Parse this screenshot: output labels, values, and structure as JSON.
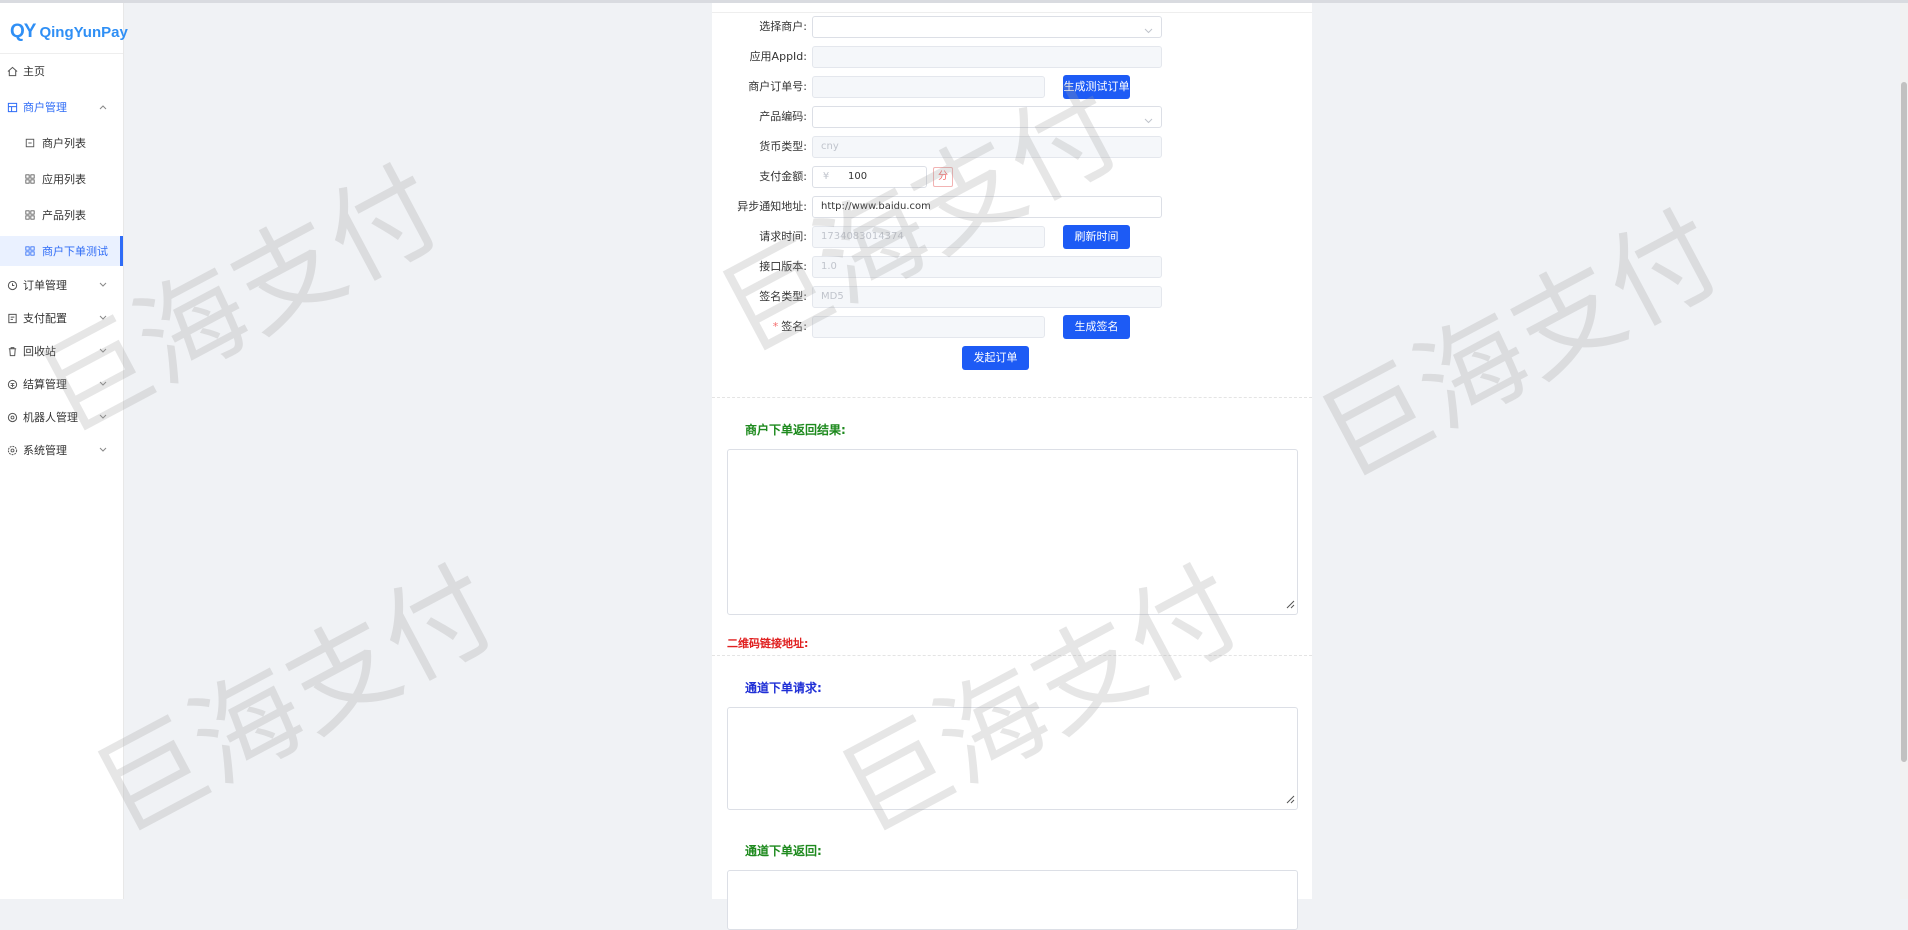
{
  "brand": {
    "mark": "QY",
    "name": "QingYunPay"
  },
  "sidebar": {
    "items": [
      {
        "label": "主页",
        "icon": "home-icon"
      },
      {
        "label": "商户管理",
        "icon": "merchant-icon",
        "expanded": true
      },
      {
        "label": "商户列表",
        "icon": "list-icon"
      },
      {
        "label": "应用列表",
        "icon": "grid-icon"
      },
      {
        "label": "产品列表",
        "icon": "grid-icon"
      },
      {
        "label": "商户下单测试",
        "icon": "grid-icon",
        "active": true
      },
      {
        "label": "订单管理",
        "icon": "order-icon"
      },
      {
        "label": "支付配置",
        "icon": "config-icon"
      },
      {
        "label": "回收站",
        "icon": "trash-icon"
      },
      {
        "label": "结算管理",
        "icon": "settle-icon"
      },
      {
        "label": "机器人管理",
        "icon": "robot-icon"
      },
      {
        "label": "系统管理",
        "icon": "settings-icon"
      }
    ]
  },
  "form": {
    "merchant": {
      "label": "选择商户:",
      "value": ""
    },
    "appid": {
      "label": "应用AppId:",
      "value": ""
    },
    "order_no": {
      "label": "商户订单号:",
      "value": "",
      "button": "生成测试订单号"
    },
    "product_code": {
      "label": "产品编码:",
      "value": ""
    },
    "currency": {
      "label": "货币类型:",
      "value": "cny"
    },
    "amount": {
      "label": "支付金额:",
      "prefix": "¥",
      "value": "100",
      "unit": "分"
    },
    "notify_url": {
      "label": "异步通知地址:",
      "value": "http://www.baidu.com"
    },
    "request_time": {
      "label": "请求时间:",
      "value": "1734083014374",
      "button": "刷新时间"
    },
    "version": {
      "label": "接口版本:",
      "value": "1.0"
    },
    "sign_type": {
      "label": "签名类型:",
      "value": "MD5"
    },
    "sign": {
      "required": "*",
      "label": "签名:",
      "value": "",
      "button": "生成签名"
    },
    "submit": "发起订单"
  },
  "sections": {
    "merchant_result": "商户下单返回结果:",
    "qr_link": "二维码链接地址:",
    "channel_request": "通道下单请求:",
    "channel_response": "通道下单返回:"
  },
  "watermark": "巨海支付",
  "colors": {
    "accent": "#1d5bf5",
    "brand": "#2f8ff5",
    "green_title": "#1e8a1e",
    "red_title": "#e02020",
    "blue_title": "#1f2fd6"
  }
}
